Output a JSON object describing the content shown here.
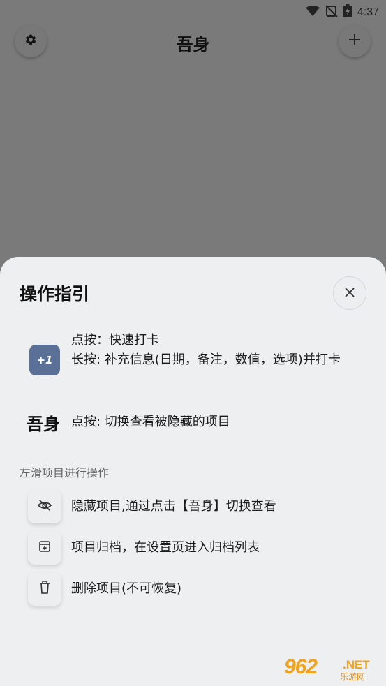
{
  "status_bar": {
    "time": "4:37"
  },
  "app_bar": {
    "title": "吾身"
  },
  "sheet": {
    "title": "操作指引",
    "plus_one_label": "+1",
    "tap_line": "点按：快速打卡",
    "long_press_line": "长按: 补充信息(日期，备注，数值，选项)并打卡",
    "brand_mark": "吾身",
    "brand_tap_line": "点按: 切换查看被隐藏的项目",
    "swipe_section_label": "左滑项目进行操作",
    "swipe_actions": [
      {
        "icon": "eye-off-icon",
        "label": "隐藏项目,通过点击【吾身】切换查看"
      },
      {
        "icon": "archive-icon",
        "label": "项目归档，在设置页进入归档列表"
      },
      {
        "icon": "trash-icon",
        "label": "删除项目(不可恢复)"
      }
    ]
  },
  "watermark": {
    "number": "962",
    "suffix": ".NET",
    "subtitle": "乐游网"
  },
  "colors": {
    "accent": "#5b7096",
    "scrim": "#7a7a7a",
    "sheet": "#eeeff1",
    "watermark": "#f2a21b"
  }
}
